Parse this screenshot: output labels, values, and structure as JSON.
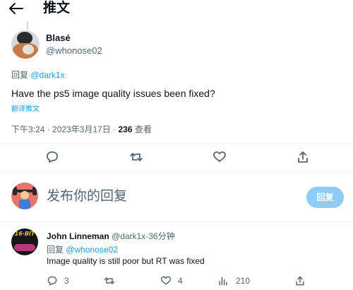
{
  "header": {
    "title": "推文"
  },
  "tweet": {
    "author_name": "Blasé",
    "author_handle": "@whonose02",
    "reply_prefix": "回复",
    "reply_target": "@dark1x",
    "text": "Have the ps5 image quality issues been fixed?",
    "translate": "翻译推文",
    "time": "下午3:24",
    "dot1": "·",
    "date": "2023年3月17日",
    "dot2": "·",
    "views_count": "236",
    "views_label": "查看"
  },
  "reply_box": {
    "placeholder": "发布你的回复",
    "button_label": "回复"
  },
  "reply": {
    "author_name": "John Linneman",
    "author_handle": "@dark1x",
    "dot": "·",
    "age": "36分钟",
    "reply_prefix": "回复",
    "reply_target": "@whonose02",
    "text": "Image quality is still poor but RT was fixed",
    "comments": "3",
    "retweets": "",
    "likes": "4",
    "views": "210"
  },
  "colors": {
    "accent": "#1d9bf0",
    "reply_button_bg": "#8ecdf8",
    "muted_text": "#536471",
    "divider": "#eff3f4"
  },
  "icons": [
    "back-arrow-icon",
    "comment-icon",
    "retweet-icon",
    "like-icon",
    "share-icon",
    "views-icon"
  ]
}
